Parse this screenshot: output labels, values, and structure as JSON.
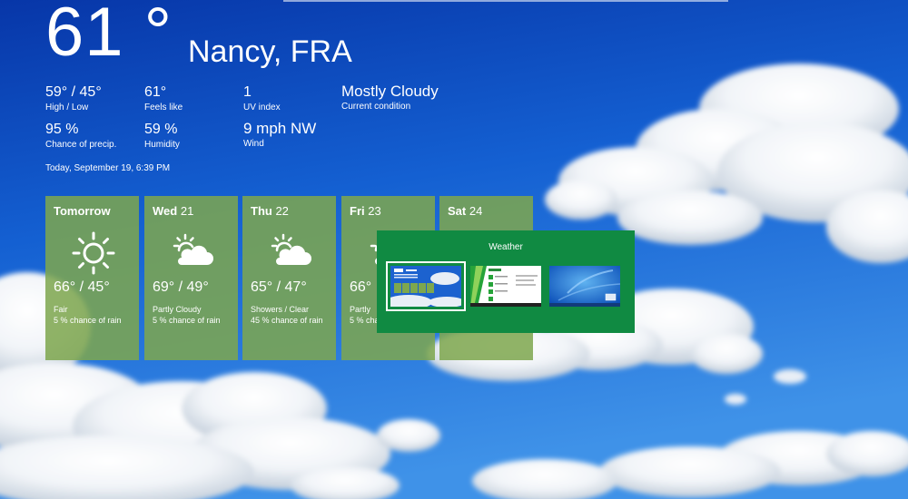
{
  "current": {
    "temperature": "61 °",
    "location": "Nancy, FRA"
  },
  "stats": [
    {
      "value": "59° / 45°",
      "label": "High / Low"
    },
    {
      "value": "61°",
      "label": "Feels like"
    },
    {
      "value": "1",
      "label": "UV index"
    },
    {
      "value": "Mostly Cloudy",
      "label": "Current condition"
    },
    {
      "value": "95 %",
      "label": "Chance of precip."
    },
    {
      "value": "59 %",
      "label": "Humidity"
    },
    {
      "value": "9 mph NW",
      "label": "Wind"
    }
  ],
  "timestamp": "Today, September 19, 6:39 PM",
  "forecast": [
    {
      "day": "Tomorrow",
      "date": "",
      "temps": "66° / 45°",
      "condition": "Fair",
      "rain": "5 % chance of rain",
      "icon": "sun-icon"
    },
    {
      "day": "Wed",
      "date": "21",
      "temps": "69° / 49°",
      "condition": "Partly Cloudy",
      "rain": "5 % chance of rain",
      "icon": "partly-cloudy-icon"
    },
    {
      "day": "Thu",
      "date": "22",
      "temps": "65° / 47°",
      "condition": "Showers / Clear",
      "rain": "45 % chance of rain",
      "icon": "partly-cloudy-icon"
    },
    {
      "day": "Fri",
      "date": "23",
      "temps": "66°",
      "condition": "Partly",
      "rain": "5 % cha",
      "icon": "partly-cloudy-icon"
    },
    {
      "day": "Sat",
      "date": "24",
      "temps": "",
      "condition": "",
      "rain": "",
      "icon": ""
    }
  ],
  "switcher": {
    "title": "Weather",
    "thumbnails": [
      "weather-app-thumbnail",
      "store-app-thumbnail",
      "desktop-thumbnail"
    ]
  },
  "colors": {
    "tile": "#7ea74e",
    "switcher": "#108a42",
    "sky_top": "#0a3fb8",
    "sky_bottom": "#3d8fe6"
  }
}
